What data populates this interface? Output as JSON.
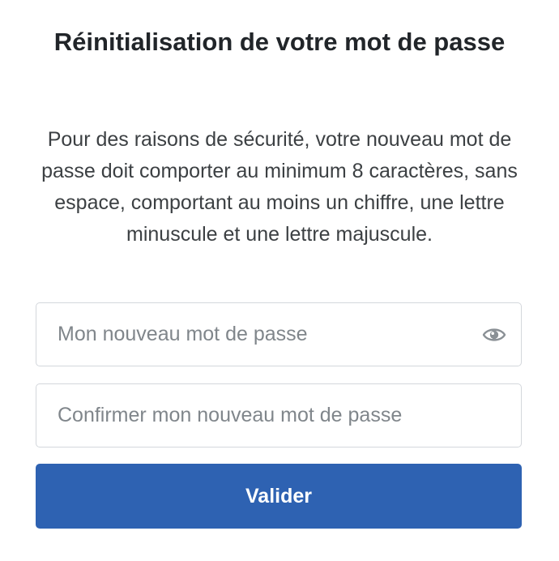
{
  "form": {
    "title": "Réinitialisation de votre mot de passe",
    "description": "Pour des raisons de sécurité, votre nouveau mot de passe doit comporter au minimum 8 caractères, sans espace, comportant au moins un chiffre, une lettre minuscule et une lettre majuscule.",
    "new_password": {
      "placeholder": "Mon nouveau mot de passe",
      "value": "",
      "toggle_icon": "eye-icon"
    },
    "confirm_password": {
      "placeholder": "Confirmer mon nouveau mot de passe",
      "value": ""
    },
    "submit_label": "Valider"
  },
  "colors": {
    "primary": "#2e62b2",
    "title_text": "#212529",
    "body_text": "#3c4043",
    "placeholder_text": "#80868b",
    "field_border": "#d3d7dc",
    "icon": "#8a9095"
  }
}
